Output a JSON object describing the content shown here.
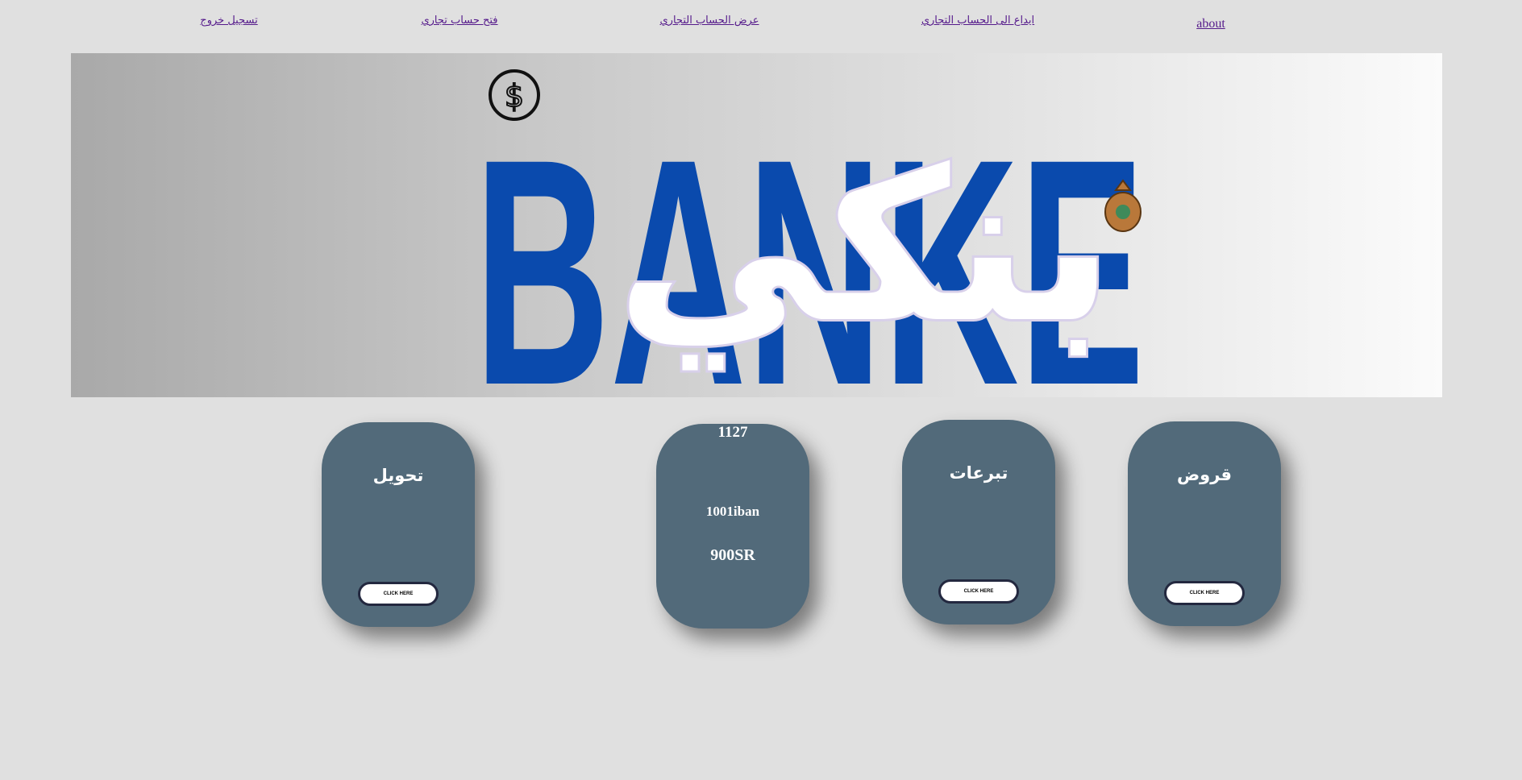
{
  "nav": {
    "logout": "تسجيل خروج",
    "open_account": "فتح حساب تجاري",
    "view_account": "عرض الحساب التجاري",
    "deposit": "ايداع الى الحساب التجاري",
    "about": "about"
  },
  "banner": {
    "logo_latin": "BANKE",
    "logo_arabic": "بنكي",
    "colors": {
      "logo_blue": "#0a4aad"
    }
  },
  "cards": {
    "transfer": {
      "title": "تحويل",
      "button": "CLICK HERE"
    },
    "account": {
      "number": "1127",
      "iban": "1001iban",
      "balance": "900SR"
    },
    "donations": {
      "title": "تبرعات",
      "button": "CLICK HERE"
    },
    "loans": {
      "title": "قروض",
      "button": "CLICK HERE"
    }
  },
  "colors": {
    "card": "#526a7a",
    "link": "#551a8b",
    "button_border": "#23283f"
  }
}
